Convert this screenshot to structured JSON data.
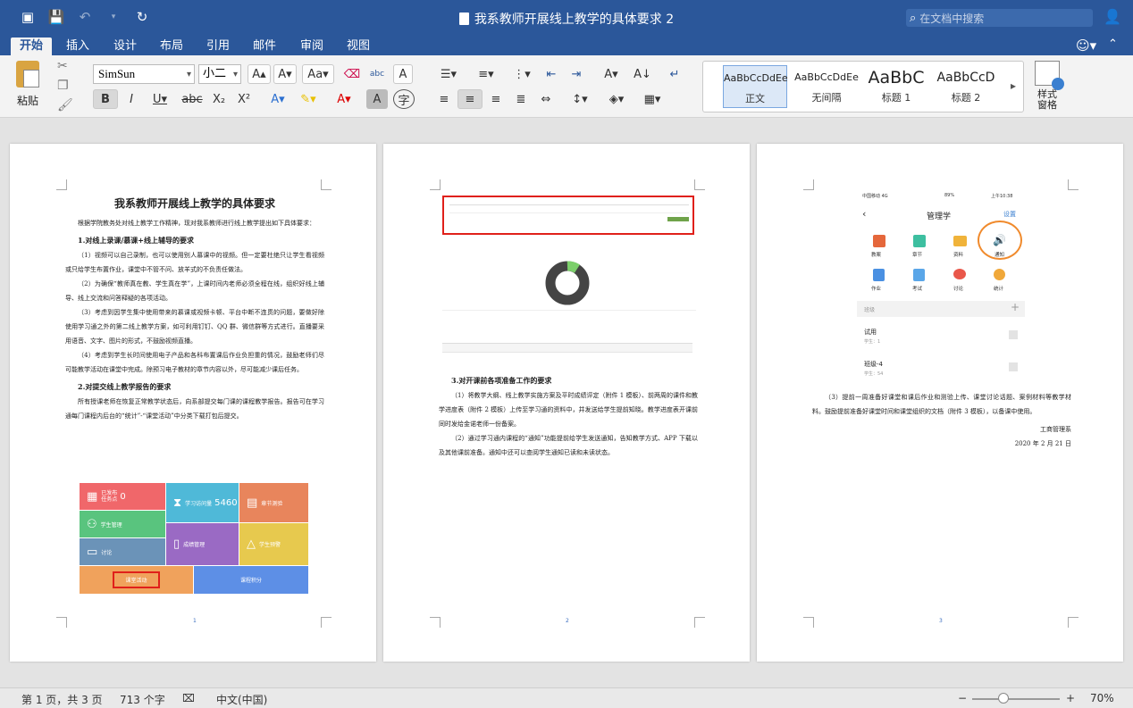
{
  "window": {
    "title": "我系教师开展线上教学的具体要求 2",
    "search_placeholder": "在文档中搜索"
  },
  "tabs": [
    "开始",
    "插入",
    "设计",
    "布局",
    "引用",
    "邮件",
    "审阅",
    "视图"
  ],
  "ribbon": {
    "paste_label": "粘贴",
    "font_name": "SimSun",
    "font_size": "小二",
    "styles": [
      {
        "sample": "AaBbCcDdEe",
        "name": "正文"
      },
      {
        "sample": "AaBbCcDdEe",
        "name": "无间隔"
      },
      {
        "sample": "AaBbC",
        "name": "标题 1"
      },
      {
        "sample": "AaBbCcD",
        "name": "标题 2"
      }
    ],
    "style_pane_label": "样式\n窗格"
  },
  "page1": {
    "title": "我系教师开展线上教学的具体要求",
    "p0": "根据学院教务处对线上教学工作精神，现对我系教师进行线上教学提出如下具体要求：",
    "h1": "1.对线上录课/慕课+线上辅导的要求",
    "p1": "（1）视频可以自己录制，也可以使用别人慕课中的视频。但一定要杜绝只让学生看视频或只给学生布置作业，课堂中不管不问、放羊式的不负责任做法。",
    "p2": "（2）为确保“教师真在教、学生真在学”，上课时间内老师必须全程在线，组织好线上辅导、线上交流和问答释疑的各项活动。",
    "p3": "（3）考虑到因学生集中使用带来的慕课或视频卡顿、平台中断不连贯的问题，要做好除使用学习通之外的第二线上教学方案，如可利用钉钉、QQ 群、微信群等方式进行。直播要采用语音、文字、图片的形式，不鼓励视频直播。",
    "p4": "（4）考虑到学生长时间使用电子产品和各科布置课后作业负担重的情况，鼓励老师们尽可能教学活动在课堂中完成。除预习电子教材的章节内容以外，尽可能减少课后任务。",
    "h2": "2.对提交线上教学报告的要求",
    "p5": "所有授课老师在恢复正常教学状态后，向系部提交每门课的课程教学报告。报告可在学习通每门课程内后台的“统计”-“课堂活动”中分类下载打包后提交。",
    "page_no": "1",
    "tiles": {
      "t1a": "已发布",
      "t1b": "任务点",
      "t1v": "0",
      "t2": "学习访问量",
      "t2v": "5460",
      "t3": "章节测验",
      "t4": "学生管理",
      "t5": "讨论",
      "t6": "成绩管理",
      "t7": "学生预警",
      "t8": "课堂活动",
      "t9": "课程积分"
    }
  },
  "page2": {
    "h3": "3.对开课前各项准备工作的要求",
    "p1": "（1）将教学大纲、线上教学实施方案及平时成绩评定（附件 1 模板）、前两周的课件和教学进度表（附件 2 模板）上传至学习通的资料中，并发送给学生提前知晓。教学进度表开课前同时发给金诺老师一份备案。",
    "p2": "（2）通过学习通内课程的“通知”功能提前给学生发送通知，告知教学方式、APP 下载以及其他课前准备。通知中还可以查阅学生通知已读和未读状态。",
    "page_no": "2"
  },
  "page3": {
    "phone_status": "中国移动 4G",
    "phone_time": "上午10:38",
    "phone_battery": "89%",
    "course_title": "管理学",
    "settings": "设置",
    "grid": [
      "教案",
      "章节",
      "资料",
      "通知",
      "作业",
      "考试",
      "讨论",
      "统计"
    ],
    "class_header": "班级",
    "classes": [
      {
        "name": "试用",
        "students": "学生：1"
      },
      {
        "name": "班级-4",
        "students": "学生：54"
      }
    ],
    "p3": "（3）提前一周准备好课堂和课后作业和测验上传、课堂讨论话题、案例材料等教学材料。鼓励提前准备好课堂时间和课堂组织的文档（附件 3 模板），以备课中使用。",
    "signature": "工商管理系",
    "date": "2020 年 2 月 21 日",
    "page_no": "3"
  },
  "status": {
    "pages": "第 1 页，共 3 页",
    "words": "713 个字",
    "language": "中文(中国)",
    "zoom": "70%"
  }
}
